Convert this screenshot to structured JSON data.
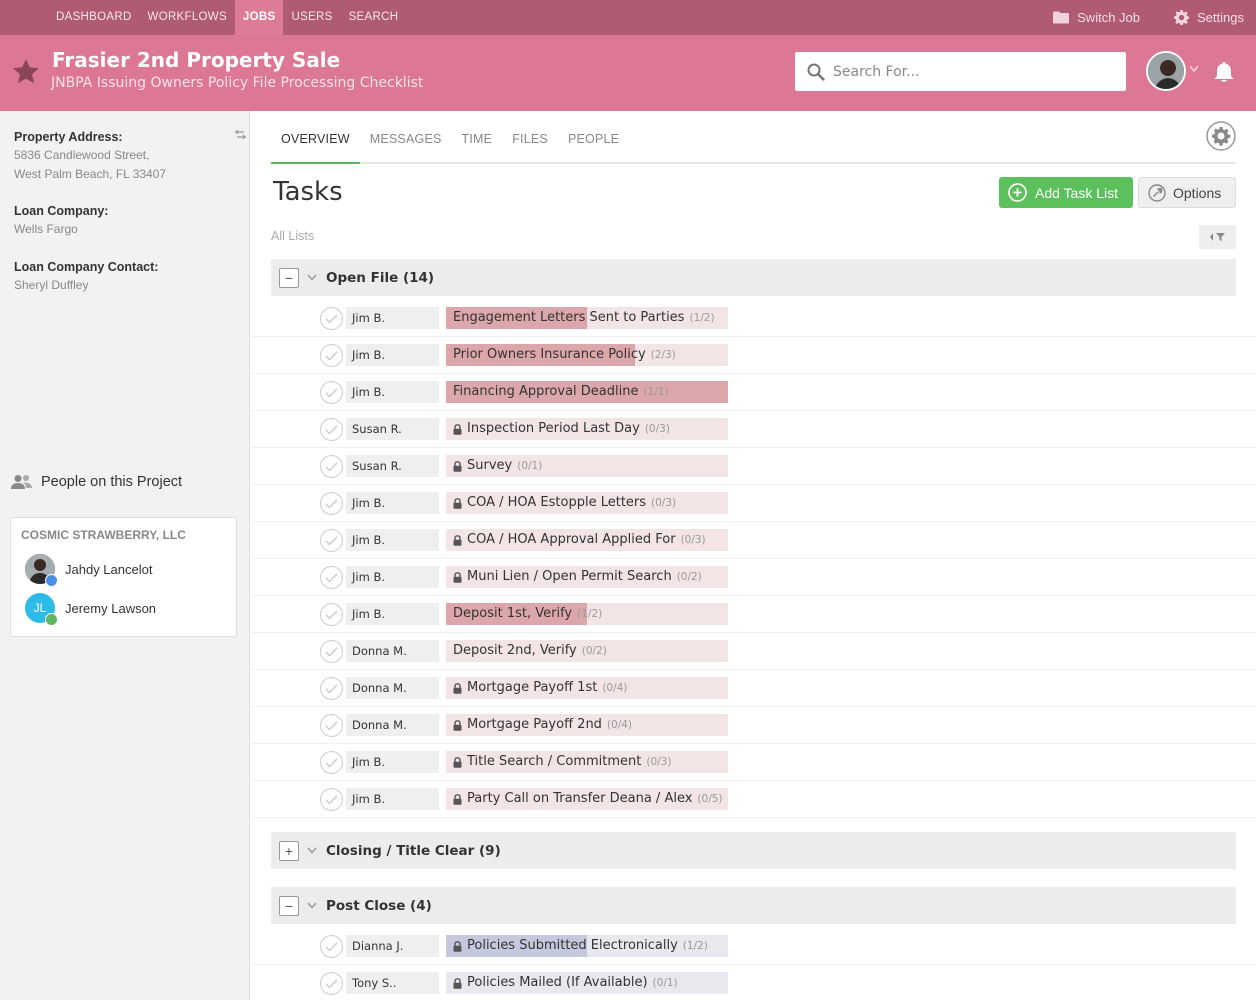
{
  "nav": {
    "items": [
      {
        "label": "DASHBOARD",
        "active": false
      },
      {
        "label": "WORKFLOWS",
        "active": false
      },
      {
        "label": "JOBS",
        "active": true
      },
      {
        "label": "USERS",
        "active": false
      },
      {
        "label": "SEARCH",
        "active": false
      }
    ],
    "switch_job": "Switch Job",
    "settings": "Settings"
  },
  "header": {
    "title": "Frasier 2nd Property Sale",
    "subtitle": "JNBPA Issuing Owners Policy File Processing Checklist",
    "search_placeholder": "Search For..."
  },
  "sidebar": {
    "property_label": "Property Address:",
    "property_line1": "5836 Candlewood Street,",
    "property_line2": "West Palm Beach, FL 33407",
    "loan_company_label": "Loan Company:",
    "loan_company": "Wells Fargo",
    "loan_contact_label": "Loan Company Contact:",
    "loan_contact": "Sheryl Duffley",
    "people_heading": "People on this Project",
    "org": "COSMIC STRAWBERRY, LLC",
    "people": [
      {
        "name": "Jahdy Lancelot",
        "initials": "",
        "badge_color": "#4a90e2"
      },
      {
        "name": "Jeremy Lawson",
        "initials": "JL",
        "badge_color": "#5cb85c"
      }
    ]
  },
  "tabs": [
    "OVERVIEW",
    "MESSAGES",
    "TIME",
    "FILES",
    "PEOPLE"
  ],
  "main": {
    "title": "Tasks",
    "add_task_list": "Add Task List",
    "options": "Options",
    "all_lists": "All Lists"
  },
  "groups": [
    {
      "name": "Open File (14)",
      "expanded": true,
      "tasks": [
        {
          "assignee": "Jim B.",
          "name": "Engagement Letters Sent to Parties",
          "count": "(1/2)",
          "progress": 0.5,
          "locked": false
        },
        {
          "assignee": "Jim B.",
          "name": "Prior Owners Insurance Policy",
          "count": "(2/3)",
          "progress": 0.67,
          "locked": false
        },
        {
          "assignee": "Jim B.",
          "name": "Financing Approval Deadline",
          "count": "(1/1)",
          "progress": 1.0,
          "locked": false
        },
        {
          "assignee": "Susan R.",
          "name": "Inspection Period Last Day",
          "count": "(0/3)",
          "progress": 0,
          "locked": true
        },
        {
          "assignee": "Susan R.",
          "name": "Survey",
          "count": "(0/1)",
          "progress": 0,
          "locked": true
        },
        {
          "assignee": "Jim B.",
          "name": "COA / HOA Estopple Letters",
          "count": "(0/3)",
          "progress": 0,
          "locked": true
        },
        {
          "assignee": "Jim B.",
          "name": "COA / HOA Approval Applied For",
          "count": "(0/3)",
          "progress": 0,
          "locked": true
        },
        {
          "assignee": "Jim B.",
          "name": "Muni Lien / Open Permit Search",
          "count": "(0/2)",
          "progress": 0,
          "locked": true
        },
        {
          "assignee": "Jim B.",
          "name": "Deposit 1st, Verify",
          "count": "(1/2)",
          "progress": 0.5,
          "locked": false
        },
        {
          "assignee": "Donna M.",
          "name": "Deposit 2nd, Verify",
          "count": "(0/2)",
          "progress": 0,
          "locked": false
        },
        {
          "assignee": "Donna M.",
          "name": "Mortgage Payoff 1st",
          "count": "(0/4)",
          "progress": 0,
          "locked": true
        },
        {
          "assignee": "Donna M.",
          "name": "Mortgage Payoff 2nd",
          "count": "(0/4)",
          "progress": 0,
          "locked": true
        },
        {
          "assignee": "Jim B.",
          "name": "Title Search / Commitment",
          "count": "(0/3)",
          "progress": 0,
          "locked": true
        },
        {
          "assignee": "Jim B.",
          "name": "Party Call on Transfer Deana / Alex",
          "count": "(0/5)",
          "progress": 0,
          "locked": true
        }
      ]
    },
    {
      "name": "Closing / Title Clear (9)",
      "expanded": false,
      "tasks": []
    },
    {
      "name": "Post Close (4)",
      "expanded": true,
      "color": "blue",
      "tasks": [
        {
          "assignee": "Dianna J.",
          "name": "Policies Submitted Electronically",
          "count": "(1/2)",
          "progress": 0.5,
          "locked": true
        },
        {
          "assignee": "Tony S..",
          "name": "Policies Mailed (If Available)",
          "count": "(0/1)",
          "progress": 0,
          "locked": true
        }
      ]
    }
  ]
}
